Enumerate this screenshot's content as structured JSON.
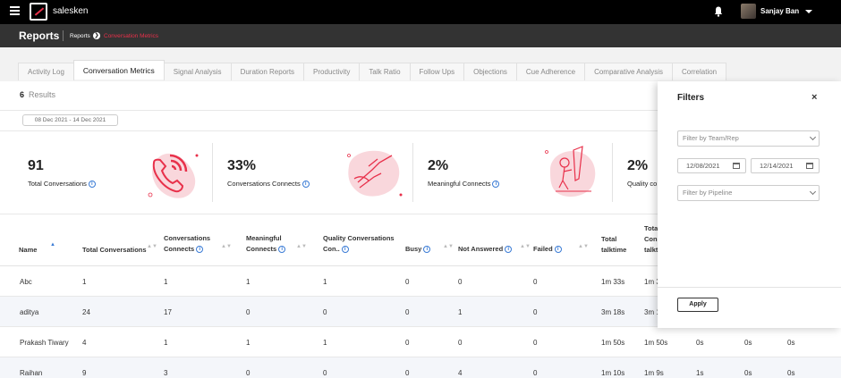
{
  "app": {
    "brand": "salesken",
    "user_name": "Sanjay Ban",
    "page_title": "Reports",
    "breadcrumb": {
      "root": "Reports",
      "separator": "❯",
      "current": "Conversation Metrics"
    }
  },
  "tabs": [
    "Activity Log",
    "Conversation Metrics",
    "Signal Analysis",
    "Duration Reports",
    "Productivity",
    "Talk Ratio",
    "Follow Ups",
    "Objections",
    "Cue Adherence",
    "Comparative Analysis",
    "Correlation"
  ],
  "active_tab": "Conversation Metrics",
  "results": {
    "count": "6",
    "label": "Results"
  },
  "date_range": "08 Dec 2021 - 14 Dec 2021",
  "metrics": [
    {
      "value": "91",
      "label": "Total Conversations"
    },
    {
      "value": "33%",
      "label": "Conversations Connects"
    },
    {
      "value": "2%",
      "label": "Meaningful Connects"
    },
    {
      "value": "2%",
      "label": "Quality co"
    }
  ],
  "table": {
    "headers": [
      "Name",
      "Total Conversations",
      "Conversations",
      "Connects",
      "Meaningful",
      "Connects",
      "Quality Conversations",
      "Con..",
      "Busy",
      "Not Answered",
      "Failed",
      "Total",
      "talktime",
      "Tota",
      "Conn",
      "talkt"
    ],
    "rows": [
      [
        "Abc",
        "1",
        "1",
        "1",
        "1",
        "0",
        "0",
        "0",
        "1m 33s",
        "1m 3",
        "",
        "",
        ""
      ],
      [
        "aditya",
        "24",
        "17",
        "0",
        "0",
        "0",
        "1",
        "0",
        "3m 18s",
        "3m 1",
        "",
        "",
        ""
      ],
      [
        "Prakash Tiwary",
        "4",
        "1",
        "1",
        "1",
        "0",
        "0",
        "0",
        "1m 50s",
        "1m 50s",
        "0s",
        "0s",
        "0s"
      ],
      [
        "Raihan",
        "9",
        "3",
        "0",
        "0",
        "0",
        "4",
        "0",
        "1m 10s",
        "1m 9s",
        "1s",
        "0s",
        "0s"
      ]
    ]
  },
  "filters": {
    "title": "Filters",
    "close": "×",
    "team_placeholder": "Filter by Team/Rep",
    "date_from": "12/08/2021",
    "date_to": "12/14/2021",
    "pipeline_placeholder": "Filter by Pipeline",
    "apply_label": "Apply"
  },
  "colors": {
    "accent": "#e8304a",
    "info": "#3a7bd5",
    "topbar": "#000000",
    "subbar": "#333333"
  }
}
